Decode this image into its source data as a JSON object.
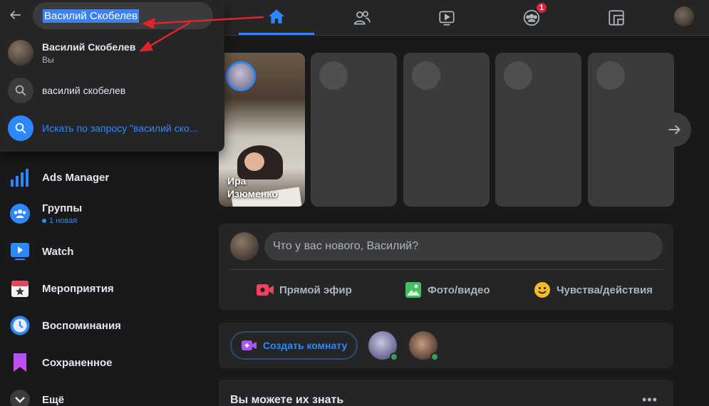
{
  "search": {
    "query": "Василий Скобелев",
    "results": [
      {
        "name": "Василий Скобелев",
        "sub": "Вы"
      },
      {
        "name": "василий скобелев"
      },
      {
        "name": "Искать по запросу \"василий ско..."
      }
    ]
  },
  "nav": {
    "tabs": [
      {
        "icon": "home-icon",
        "active": true
      },
      {
        "icon": "friends-icon"
      },
      {
        "icon": "watch-icon"
      },
      {
        "icon": "groups-icon",
        "badge": "1"
      },
      {
        "icon": "gaming-icon"
      }
    ]
  },
  "sidebar": {
    "items": [
      {
        "label": "Ads Manager",
        "icon": "ads-manager-icon"
      },
      {
        "label": "Группы",
        "sub": "1 новая",
        "icon": "groups-icon"
      },
      {
        "label": "Watch",
        "icon": "watch-icon"
      },
      {
        "label": "Мероприятия",
        "icon": "events-icon"
      },
      {
        "label": "Воспоминания",
        "icon": "memories-icon"
      },
      {
        "label": "Сохраненное",
        "icon": "saved-icon"
      },
      {
        "label": "Ещё",
        "icon": "chevron-down-icon"
      }
    ]
  },
  "stories": {
    "first_name": "Ира Изюменко"
  },
  "composer": {
    "placeholder": "Что у вас нового, Василий?",
    "actions": [
      {
        "label": "Прямой эфир",
        "icon": "live-video-icon",
        "color": "#f3425f"
      },
      {
        "label": "Фото/видео",
        "icon": "photo-video-icon",
        "color": "#45bd62"
      },
      {
        "label": "Чувства/действия",
        "icon": "feeling-icon",
        "color": "#f7b928"
      }
    ]
  },
  "rooms": {
    "create_label": "Создать комнату"
  },
  "pymk": {
    "title": "Вы можете их знать",
    "more": "•••"
  },
  "colors": {
    "accent": "#2d88ff",
    "background": "#18191a",
    "surface": "#242526",
    "annotation": "#e0242b"
  }
}
